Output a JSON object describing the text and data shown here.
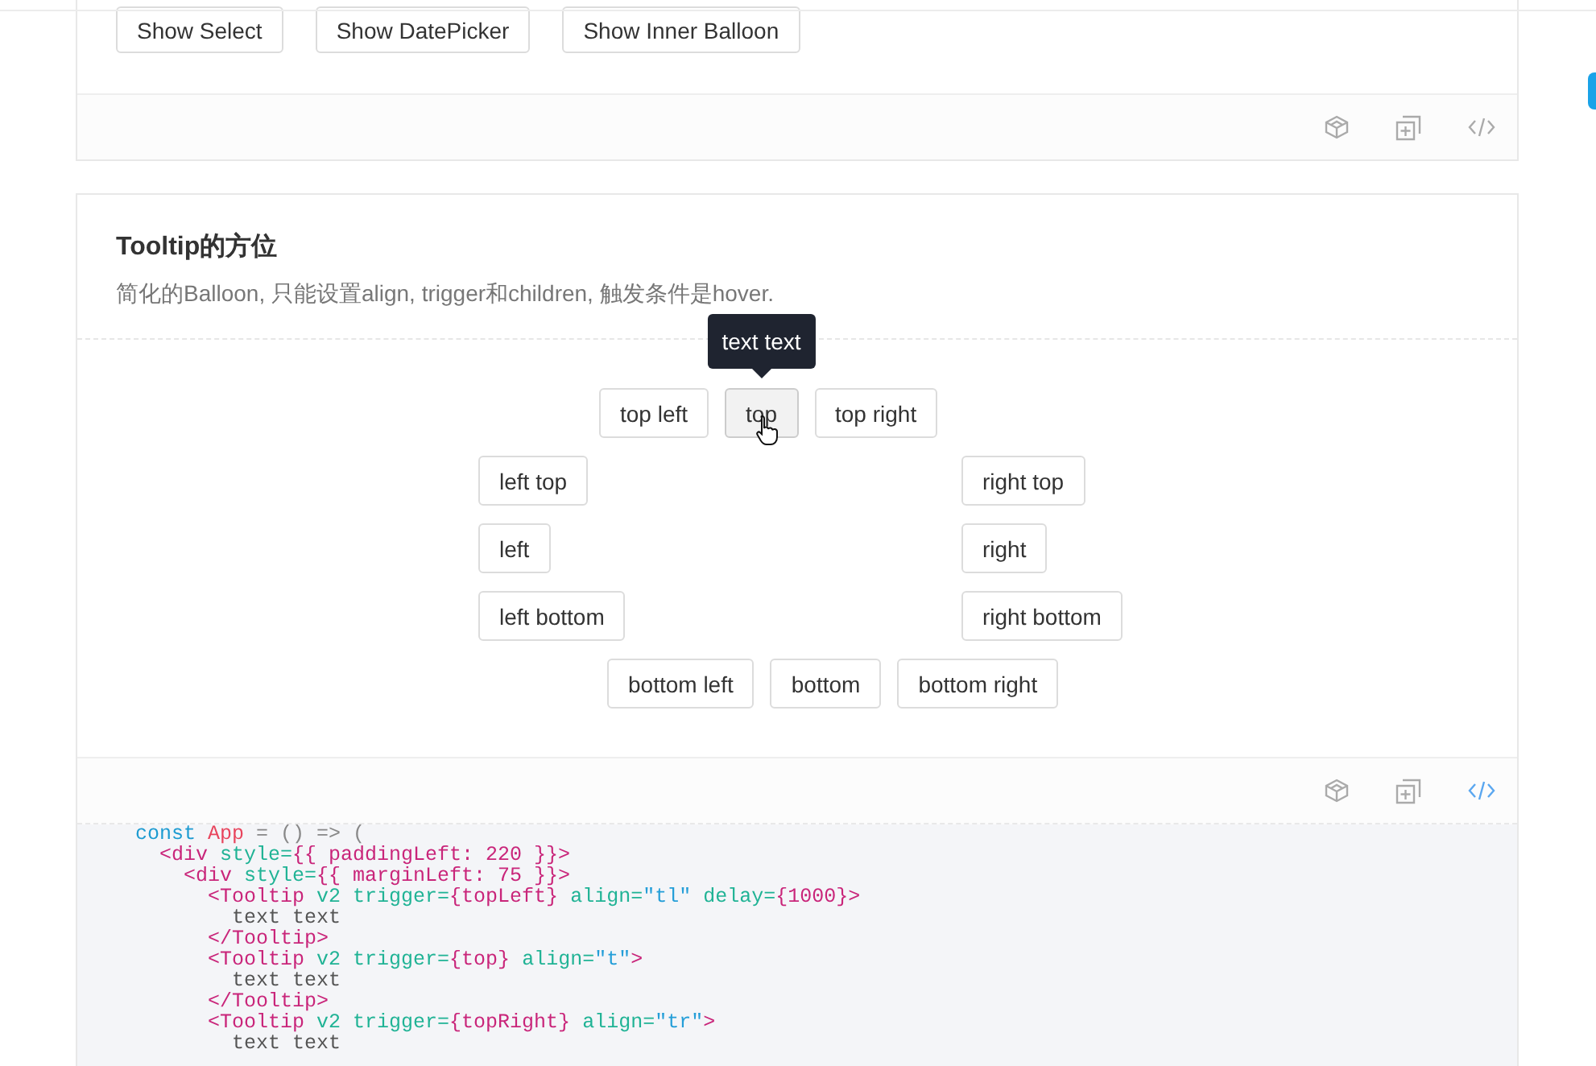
{
  "top_demo": {
    "buttons": [
      {
        "label": "Show Select"
      },
      {
        "label": "Show DatePicker"
      },
      {
        "label": "Show Inner Balloon"
      }
    ],
    "code_expanded": false
  },
  "tooltip_demo": {
    "title": "Tooltip的方位",
    "description": "简化的Balloon, 只能设置align, trigger和children, 触发条件是hover.",
    "tooltip": {
      "text": "text text"
    },
    "rows": [
      {
        "kind": "top",
        "buttons": [
          {
            "label": "top left",
            "hovered": false
          },
          {
            "label": "top",
            "hovered": true
          },
          {
            "label": "top right",
            "hovered": false
          }
        ]
      },
      {
        "kind": "side",
        "buttons": [
          {
            "label": "left top",
            "hovered": false
          },
          {
            "label": "right top",
            "hovered": false
          }
        ]
      },
      {
        "kind": "side",
        "buttons": [
          {
            "label": "left",
            "hovered": false
          },
          {
            "label": "right",
            "hovered": false
          }
        ]
      },
      {
        "kind": "side",
        "buttons": [
          {
            "label": "left bottom",
            "hovered": false
          },
          {
            "label": "right bottom",
            "hovered": false
          }
        ]
      },
      {
        "kind": "bottom",
        "buttons": [
          {
            "label": "bottom left",
            "hovered": false
          },
          {
            "label": "bottom",
            "hovered": false
          },
          {
            "label": "bottom right",
            "hovered": false
          }
        ]
      }
    ],
    "code_expanded": true,
    "code_lines": [
      [
        {
          "kind": "keyword",
          "text": "const "
        },
        {
          "kind": "name",
          "text": "App"
        },
        {
          "kind": "punct",
          "text": " = () => ("
        }
      ],
      [
        {
          "kind": "tag",
          "text": "  <div "
        },
        {
          "kind": "attr",
          "text": "style="
        },
        {
          "kind": "tag",
          "text": "{{ paddingLeft: 220 }}>"
        }
      ],
      [
        {
          "kind": "tag",
          "text": "    <div "
        },
        {
          "kind": "attr",
          "text": "style="
        },
        {
          "kind": "tag",
          "text": "{{ marginLeft: 75 }}>"
        }
      ],
      [
        {
          "kind": "tag",
          "text": "      <Tooltip "
        },
        {
          "kind": "attr",
          "text": "v2 trigger="
        },
        {
          "kind": "tag",
          "text": "{topLeft} "
        },
        {
          "kind": "attr",
          "text": "align="
        },
        {
          "kind": "string",
          "text": "\"tl\" "
        },
        {
          "kind": "attr",
          "text": "delay="
        },
        {
          "kind": "tag",
          "text": "{1000}>"
        }
      ],
      [
        {
          "kind": "text",
          "text": "        text text"
        }
      ],
      [
        {
          "kind": "tag",
          "text": "      </Tooltip>"
        }
      ],
      [
        {
          "kind": "tag",
          "text": "      <Tooltip "
        },
        {
          "kind": "attr",
          "text": "v2 trigger="
        },
        {
          "kind": "tag",
          "text": "{top} "
        },
        {
          "kind": "attr",
          "text": "align="
        },
        {
          "kind": "string",
          "text": "\"t\""
        },
        {
          "kind": "tag",
          "text": ">"
        }
      ],
      [
        {
          "kind": "text",
          "text": "        text text"
        }
      ],
      [
        {
          "kind": "tag",
          "text": "      </Tooltip>"
        }
      ],
      [
        {
          "kind": "tag",
          "text": "      <Tooltip "
        },
        {
          "kind": "attr",
          "text": "v2 trigger="
        },
        {
          "kind": "tag",
          "text": "{topRight} "
        },
        {
          "kind": "attr",
          "text": "align="
        },
        {
          "kind": "string",
          "text": "\"tr\""
        },
        {
          "kind": "tag",
          "text": ">"
        }
      ],
      [
        {
          "kind": "text",
          "text": "        text text"
        }
      ]
    ]
  }
}
